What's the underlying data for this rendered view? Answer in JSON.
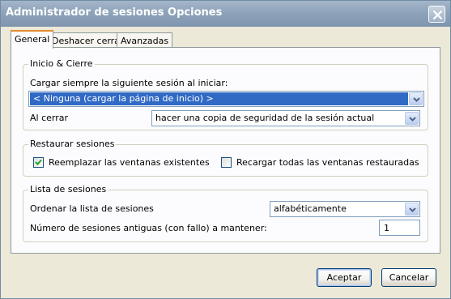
{
  "window": {
    "title": "Administrador de sesiones Opciones"
  },
  "tabs": [
    {
      "label": "General",
      "active": true
    },
    {
      "label": "Deshacer cerrar",
      "active": false
    },
    {
      "label": "Avanzadas",
      "active": false
    }
  ],
  "inicio_cierre": {
    "legend": "Inicio & Cierre",
    "startup_label": "Cargar siempre la siguiente sesión al iniciar:",
    "startup_value": "< Ninguna (cargar la página de inicio) >",
    "close_label": "Al cerrar",
    "close_value": "hacer una copia de seguridad de la sesión actual"
  },
  "restaurar": {
    "legend": "Restaurar sesiones",
    "replace_label": "Reemplazar las ventanas existentes",
    "replace_checked": true,
    "reload_label": "Recargar todas las ventanas restauradas",
    "reload_checked": false
  },
  "lista": {
    "legend": "Lista de sesiones",
    "sort_label": "Ordenar la lista de sesiones",
    "sort_value": "alfabéticamente",
    "old_label": "Número de sesiones antiguas (con fallo) a mantener:",
    "old_value": "1"
  },
  "buttons": {
    "accept": "Aceptar",
    "cancel": "Cancelar"
  },
  "colors": {
    "selection": "#316ac5",
    "tab_highlight": "#e68b2c",
    "titlebar": "#8ea3ba"
  },
  "icons": {
    "close": "close-icon",
    "dropdown": "chevron-down-icon",
    "check": "checkmark-icon"
  }
}
